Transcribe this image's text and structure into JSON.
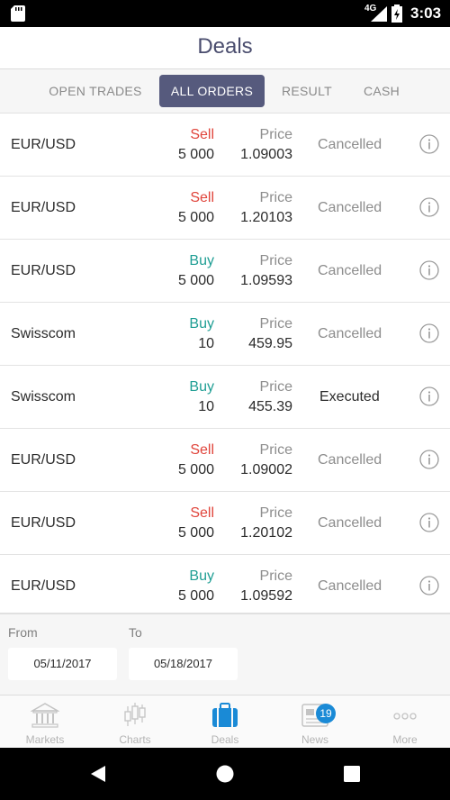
{
  "status_bar": {
    "network": "4G",
    "time": "3:03"
  },
  "header": {
    "title": "Deals"
  },
  "tabs": [
    {
      "label": "OPEN TRADES",
      "active": false
    },
    {
      "label": "ALL ORDERS",
      "active": true
    },
    {
      "label": "RESULT",
      "active": false
    },
    {
      "label": "CASH",
      "active": false
    }
  ],
  "orders": [
    {
      "instrument": "EUR/USD",
      "side": "Sell",
      "quantity": "5 000",
      "price_label": "Price",
      "price": "1.09003",
      "status": "Cancelled"
    },
    {
      "instrument": "EUR/USD",
      "side": "Sell",
      "quantity": "5 000",
      "price_label": "Price",
      "price": "1.20103",
      "status": "Cancelled"
    },
    {
      "instrument": "EUR/USD",
      "side": "Buy",
      "quantity": "5 000",
      "price_label": "Price",
      "price": "1.09593",
      "status": "Cancelled"
    },
    {
      "instrument": "Swisscom",
      "side": "Buy",
      "quantity": "10",
      "price_label": "Price",
      "price": "459.95",
      "status": "Cancelled"
    },
    {
      "instrument": "Swisscom",
      "side": "Buy",
      "quantity": "10",
      "price_label": "Price",
      "price": "455.39",
      "status": "Executed"
    },
    {
      "instrument": "EUR/USD",
      "side": "Sell",
      "quantity": "5 000",
      "price_label": "Price",
      "price": "1.09002",
      "status": "Cancelled"
    },
    {
      "instrument": "EUR/USD",
      "side": "Sell",
      "quantity": "5 000",
      "price_label": "Price",
      "price": "1.20102",
      "status": "Cancelled"
    },
    {
      "instrument": "EUR/USD",
      "side": "Buy",
      "quantity": "5 000",
      "price_label": "Price",
      "price": "1.09592",
      "status": "Cancelled"
    }
  ],
  "date_filter": {
    "from_label": "From",
    "from_value": "05/11/2017",
    "to_label": "To",
    "to_value": "05/18/2017"
  },
  "bottom_nav": [
    {
      "label": "Markets",
      "icon": "bank-icon",
      "active": false
    },
    {
      "label": "Charts",
      "icon": "candlestick-icon",
      "active": false
    },
    {
      "label": "Deals",
      "icon": "briefcase-icon",
      "active": true
    },
    {
      "label": "News",
      "icon": "newspaper-icon",
      "active": false,
      "badge": "19"
    },
    {
      "label": "More",
      "icon": "more-dots-icon",
      "active": false
    }
  ],
  "colors": {
    "accent": "#565a7d",
    "sell": "#e0443b",
    "buy": "#1f9e94",
    "active_nav": "#1a8ad6"
  }
}
